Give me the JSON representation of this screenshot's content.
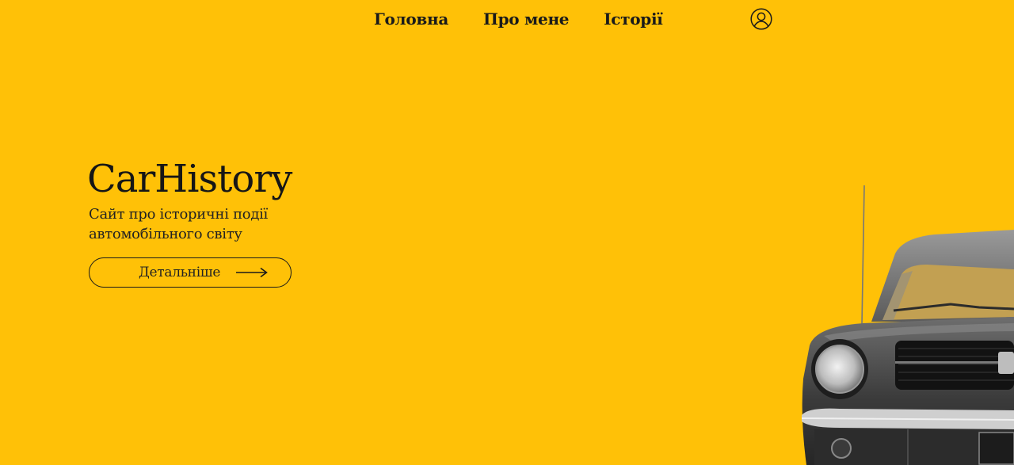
{
  "nav": {
    "items": [
      {
        "label": "Головна"
      },
      {
        "label": "Про мене"
      },
      {
        "label": "Історії"
      }
    ],
    "account_icon": "user-circle-icon"
  },
  "hero": {
    "title": "CarHistory",
    "subtitle": "Сайт про історичні події автомобільного світу",
    "button_label": "Детальніше",
    "button_icon": "arrow-right-icon"
  },
  "colors": {
    "background": "#FFC107",
    "text": "#1a1a1a"
  }
}
